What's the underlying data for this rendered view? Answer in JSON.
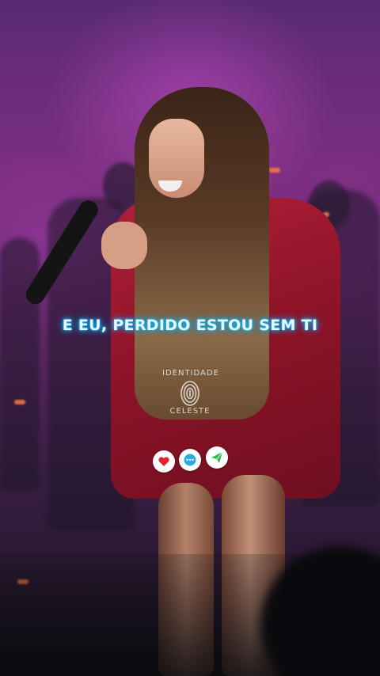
{
  "caption": {
    "text": "E EU, PERDIDO ESTOU SEM TI",
    "color": "#e8f8ff",
    "glow_color": "#00b8ff"
  },
  "watermark": {
    "top_text": "IDENTIDADE",
    "bottom_text": "CELESTE"
  },
  "actions": [
    {
      "icon": "heart-icon",
      "color": "#e0252b"
    },
    {
      "icon": "comment-icon",
      "color": "#2aa8e8"
    },
    {
      "icon": "send-icon",
      "color": "#2fb84a"
    }
  ]
}
